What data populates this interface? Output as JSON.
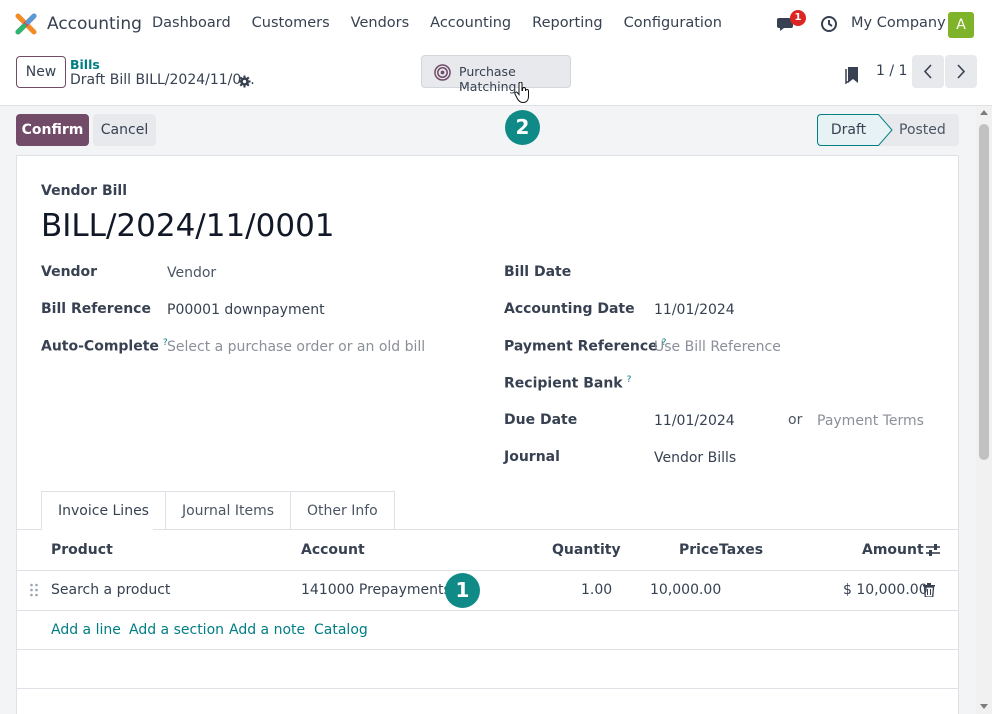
{
  "topbar": {
    "app_name": "Accounting",
    "menu": [
      "Dashboard",
      "Customers",
      "Vendors",
      "Accounting",
      "Reporting",
      "Configuration"
    ],
    "chat_badge": "1",
    "company": "My Company",
    "avatar_letter": "A",
    "avatar_color": "#7fb32a"
  },
  "control": {
    "new_label": "New",
    "breadcrumb_parent": "Bills",
    "breadcrumb_current": "Draft Bill BILL/2024/11/0...",
    "purchase_matching_label": "Purchase Matching",
    "pager": "1 / 1"
  },
  "actions": {
    "confirm_label": "Confirm",
    "cancel_label": "Cancel",
    "status_draft": "Draft",
    "status_posted": "Posted"
  },
  "markers": {
    "one": "1",
    "two": "2"
  },
  "form": {
    "doc_type": "Vendor Bill",
    "title": "BILL/2024/11/0001",
    "vendor_label": "Vendor",
    "vendor_value": "Vendor",
    "bill_ref_label": "Bill Reference",
    "bill_ref_value": "P00001 downpayment",
    "auto_complete_label": "Auto-Complete",
    "auto_complete_placeholder": "Select a purchase order or an old bill",
    "bill_date_label": "Bill Date",
    "accounting_date_label": "Accounting Date",
    "accounting_date_value": "11/01/2024",
    "payment_ref_label": "Payment Reference",
    "payment_ref_placeholder": "Use Bill Reference",
    "recipient_bank_label": "Recipient Bank",
    "due_date_label": "Due Date",
    "due_date_value": "11/01/2024",
    "or_label": "or",
    "payment_terms_placeholder": "Payment Terms",
    "journal_label": "Journal",
    "journal_value": "Vendor Bills",
    "help_mark": "?"
  },
  "tabs": [
    "Invoice Lines",
    "Journal Items",
    "Other Info"
  ],
  "lines": {
    "headers": {
      "product": "Product",
      "account": "Account",
      "quantity": "Quantity",
      "price": "Price",
      "taxes": "Taxes",
      "amount": "Amount"
    },
    "row": {
      "product_placeholder": "Search a product",
      "account": "141000 Prepayments",
      "quantity": "1.00",
      "price": "10,000.00",
      "amount": "$ 10,000.00"
    },
    "links": [
      "Add a line",
      "Add a section",
      "Add a note",
      "Catalog"
    ]
  },
  "icons": {
    "logo": "odoo-accounting-logo-icon",
    "chat": "chat-icon",
    "clock": "clock-icon",
    "gear": "gear-icon",
    "purchase_matching": "target-icon",
    "bookmark": "bookmark-icon",
    "prev": "chevron-left-icon",
    "next": "chevron-right-icon",
    "drag": "drag-handle-icon",
    "trash": "trash-icon",
    "column_options": "sliders-icon"
  },
  "colors": {
    "brand": "#714b67",
    "link": "#017e84",
    "marker": "#0f8a86",
    "badge": "#dc2626"
  }
}
